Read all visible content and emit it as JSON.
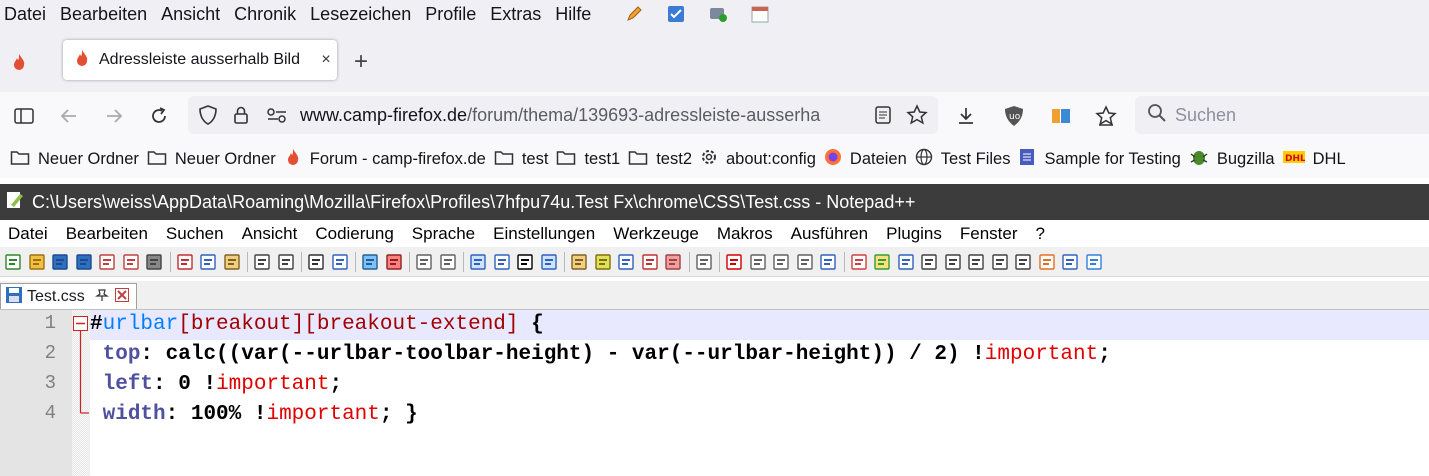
{
  "firefox": {
    "menu": [
      "Datei",
      "Bearbeiten",
      "Ansicht",
      "Chronik",
      "Lesezeichen",
      "Profile",
      "Extras",
      "Hilfe"
    ],
    "tab": {
      "title": "Adressleiste ausserhalb Bild",
      "close": "×"
    },
    "new_tab": "+",
    "url": {
      "domain": "www.camp-firefox.de",
      "path": "/forum/thema/139693-adressleiste-ausserha"
    },
    "search_placeholder": "Suchen",
    "bookmarks": [
      {
        "label": "Neuer Ordner",
        "icon": "folder-icon"
      },
      {
        "label": "Neuer Ordner",
        "icon": "folder-icon"
      },
      {
        "label": "Forum - camp-firefox.de",
        "icon": "flame-icon"
      },
      {
        "label": "test",
        "icon": "folder-icon"
      },
      {
        "label": "test1",
        "icon": "folder-icon"
      },
      {
        "label": "test2",
        "icon": "folder-icon"
      },
      {
        "label": "about:config",
        "icon": "gear-icon"
      },
      {
        "label": "Dateien",
        "icon": "firefox-icon"
      },
      {
        "label": "Test Files",
        "icon": "globe-icon"
      },
      {
        "label": "Sample for Testing",
        "icon": "page-icon"
      },
      {
        "label": "Bugzilla",
        "icon": "bug-icon"
      },
      {
        "label": "DHL",
        "icon": "dhl-icon"
      }
    ]
  },
  "notepad": {
    "title": "C:\\Users\\weiss\\AppData\\Roaming\\Mozilla\\Firefox\\Profiles\\7hfpu74u.Test Fx\\chrome\\CSS\\Test.css - Notepad++",
    "menu": [
      "Datei",
      "Bearbeiten",
      "Suchen",
      "Ansicht",
      "Codierung",
      "Sprache",
      "Einstellungen",
      "Werkzeuge",
      "Makros",
      "Ausführen",
      "Plugins",
      "Fenster",
      "?"
    ],
    "tab": "Test.css",
    "line_numbers": [
      "1",
      "2",
      "3",
      "4"
    ],
    "code": {
      "l1": {
        "hash": "#",
        "sel": "urlbar",
        "a1": "[breakout]",
        "a2": "[breakout-extend]",
        "rest": " {"
      },
      "l2": {
        "prop": "top",
        "colon": ": ",
        "val": "calc((var(--urlbar-toolbar-height) - var(--urlbar-height)) / 2) !",
        "imp": "important",
        "end": ";"
      },
      "l3": {
        "prop": "left",
        "colon": ": ",
        "val": "0 !",
        "imp": "important",
        "end": ";"
      },
      "l4": {
        "prop": "width",
        "colon": ": ",
        "val": "100% !",
        "imp": "important",
        "end": "; }"
      }
    }
  },
  "colors": {
    "accent": "#0060df",
    "selector": "#0080ff",
    "attribute": "#a00000",
    "property": "#5050a0",
    "important": "#e00000",
    "titlebar": "#3c3c3c"
  }
}
